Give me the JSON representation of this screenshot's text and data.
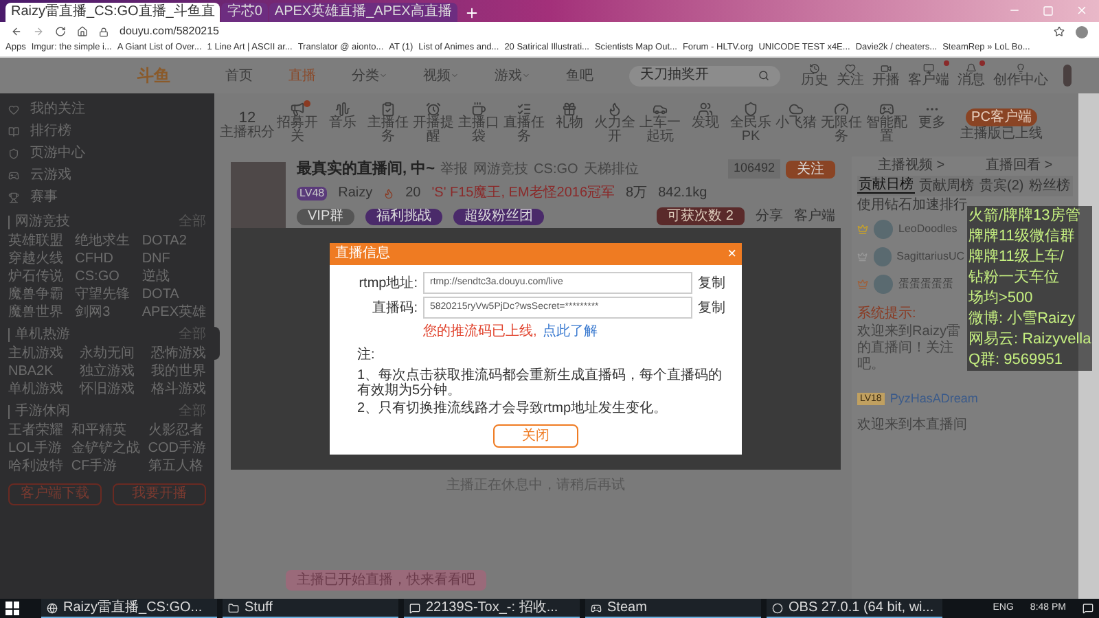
{
  "browser": {
    "tabs": [
      {
        "title": "Raizy雷直播_CS:GO直播_斗鱼直",
        "selected": true
      },
      {
        "title": "字芯0",
        "selected": false
      },
      {
        "title": "APEX英雄直播_APEX高直播",
        "selected": false
      }
    ],
    "address": "douyu.com/5820215",
    "bookmarks": [
      "Apps",
      "Imgur: the simple i...",
      "A Giant List of Over...",
      "1 Line Art | ASCII ar...",
      "Translator @ aionto...",
      "AT (1)",
      "List of Animes and...",
      "20 Satirical Illustrati...",
      "Scientists Map Out...",
      "Forum - HLTV.org",
      "UNICODE TEST x4E...",
      "Davie2k / cheaters...",
      "SteamRep » LoL Bo..."
    ]
  },
  "site_header": {
    "logo": "斗鱼",
    "nav": [
      {
        "label": "首页",
        "selected": false,
        "dropdown": false
      },
      {
        "label": "直播",
        "selected": true,
        "dropdown": false
      },
      {
        "label": "分类",
        "selected": false,
        "dropdown": true
      },
      {
        "label": "视频",
        "selected": false,
        "dropdown": true
      },
      {
        "label": "游戏",
        "selected": false,
        "dropdown": true
      },
      {
        "label": "鱼吧",
        "selected": false,
        "dropdown": false
      }
    ],
    "search": {
      "placeholder": "天刀抽奖开"
    },
    "icons": [
      {
        "label": "历史",
        "badge": false
      },
      {
        "label": "关注",
        "badge": false
      },
      {
        "label": "开播",
        "badge": false
      },
      {
        "label": "客户端",
        "badge": true
      },
      {
        "label": "消息",
        "badge": true
      },
      {
        "label": "创作中心",
        "badge": false
      }
    ]
  },
  "sidebar": {
    "items": [
      "我的关注",
      "排行榜",
      "页游中心",
      "云游戏",
      "赛事"
    ],
    "sections": [
      {
        "title": "网游竞技",
        "more": "全部",
        "games": [
          "英雄联盟",
          "绝地求生",
          "DOTA2",
          "穿越火线",
          "CFHD",
          "DNF",
          "炉石传说",
          "CS:GO",
          "逆战",
          "魔兽争霸",
          "守望先锋",
          "DOTA",
          "魔兽世界",
          "剑网3",
          "APEX英雄"
        ]
      },
      {
        "title": "单机热游",
        "more": "全部",
        "games": [
          "主机游戏",
          "永劫无间",
          "恐怖游戏",
          "NBA2K",
          "独立游戏",
          "我的世界",
          "单机游戏",
          "怀旧游戏",
          "格斗游戏"
        ]
      },
      {
        "title": "手游休闲",
        "more": "全部",
        "games": [
          "王者荣耀",
          "和平精英",
          "火影忍者",
          "LOL手游",
          "金铲铲之战",
          "COD手游",
          "哈利波特",
          "CF手游",
          "第五人格"
        ]
      }
    ],
    "buttons": [
      "客户端下载",
      "我要开播"
    ]
  },
  "toolbar": {
    "score": {
      "value": "12",
      "label": "主播积分"
    },
    "items": [
      {
        "label": "招募开关",
        "badge": true
      },
      {
        "label": "音乐",
        "badge": false
      },
      {
        "label": "主播任务",
        "badge": false
      },
      {
        "label": "开播提醒",
        "badge": false
      },
      {
        "label": "主播口袋",
        "badge": false
      },
      {
        "label": "直播任务",
        "badge": false
      },
      {
        "label": "礼物",
        "badge": false
      },
      {
        "label": "火力全开",
        "badge": false
      },
      {
        "label": "上车一起玩",
        "badge": false
      },
      {
        "label": "发现",
        "badge": false
      },
      {
        "label": "全民乐PK",
        "badge": false
      },
      {
        "label": "小飞猪",
        "badge": false
      },
      {
        "label": "无限任务",
        "badge": false
      },
      {
        "label": "智能配置",
        "badge": false
      },
      {
        "label": "更多",
        "badge": false
      }
    ],
    "pc_client": {
      "label": "PC客户端",
      "caption": "主播版已上线"
    }
  },
  "room": {
    "title": "最真实的直播间, 中~",
    "report": "举报",
    "breadcrumb": [
      "网游竞技",
      "CS:GO",
      "天梯排位"
    ],
    "level": "LV48",
    "streamer": "Raizy",
    "heat": "20",
    "promo": "'S' F15魔王, EM老怪2016冠军",
    "fans": "8万",
    "weight": "842.1kg",
    "chips": [
      "VIP群",
      "福利挑战",
      "超级粉丝团"
    ],
    "follow_count": "106492",
    "follow": "关注",
    "gift": "可获次数 2",
    "share": "分享",
    "client": "客户端"
  },
  "player": {
    "modal": {
      "title": "直播信息",
      "close": "×",
      "fields": [
        {
          "label": "rtmp地址:",
          "value": "rtmp://sendtc3a.douyu.com/live",
          "copy": "复制"
        },
        {
          "label": "直播码:",
          "value": "5820215ryVw5PjDc?wsSecret=*********",
          "copy": "复制"
        }
      ],
      "warning": "您的推流码已上线,",
      "link": "点此了解",
      "notes_title": "注:",
      "notes": [
        "1、每次点击获取推流码都会重新生成直播码，每个直播码的有效期为5分钟。",
        "2、只有切换推流线路才会导致rtmp地址发生变化。"
      ],
      "button": "关闭"
    },
    "below": "主播正在休息中，请稍后再试",
    "toast": "主播已开始直播，快来看看吧"
  },
  "right_panel": {
    "tabs": [
      "主播视频 >",
      "直播回看 >"
    ],
    "rank_tabs": [
      {
        "label": "贡献日榜",
        "selected": true
      },
      {
        "label": "贡献周榜",
        "selected": false
      },
      {
        "label": "贵宾(2)",
        "selected": false
      },
      {
        "label": "粉丝榜",
        "selected": false
      }
    ],
    "rank_note": "使用钻石加速排行",
    "ranks": [
      {
        "name": "LeoDoodles",
        "color": "#c9a227"
      },
      {
        "name": "SagittariusUC",
        "color": "#9a9a9a"
      },
      {
        "name": "蛋蛋蛋蛋蛋",
        "color": "#a0603a"
      }
    ],
    "system": {
      "label": "系统提示:",
      "text": "欢迎来到Raizy雷的直播间！关注吧。"
    },
    "chat": [
      {
        "level": "LV18",
        "user": "PyzHasADream",
        "text": "欢迎来到本直播间"
      }
    ]
  },
  "stream_overlay": {
    "lines": [
      "火箭/牌牌13房管",
      "牌牌11级微信群",
      "牌牌11级上车/",
      "钻粉一天车位",
      "场均>500",
      "微博: 小雪Raizy",
      "网易云: Raizyvella",
      "Q群: 9569951"
    ]
  },
  "taskbar": {
    "apps": [
      "Raizy雷直播_CS:GO...",
      "Stuff",
      "22139S-Tox_-: 招收...",
      "Steam",
      "OBS 27.0.1 (64 bit, wi..."
    ],
    "language": "ENG",
    "time": "8:48 PM"
  }
}
